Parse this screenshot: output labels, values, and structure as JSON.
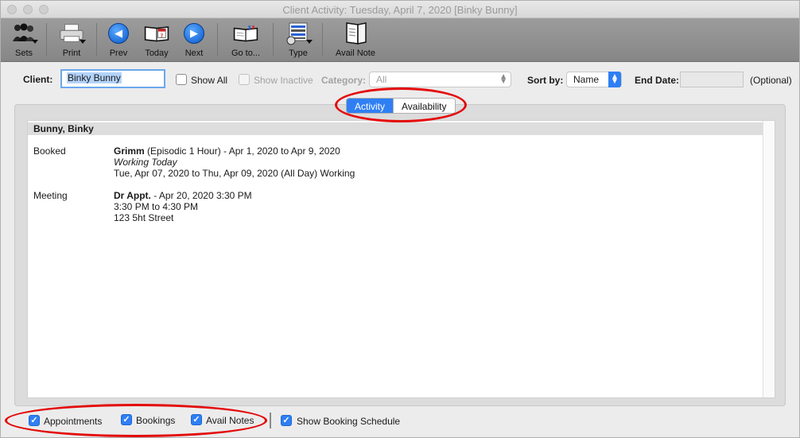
{
  "window": {
    "title": "Client Activity: Tuesday, April 7, 2020 [Binky Bunny]"
  },
  "toolbar": {
    "items": [
      {
        "label": "Sets",
        "icon": "people-icon"
      },
      {
        "label": "Print",
        "icon": "printer-icon"
      },
      {
        "label": "Prev",
        "icon": "arrow-left-icon"
      },
      {
        "label": "Today",
        "icon": "calendar-icon"
      },
      {
        "label": "Next",
        "icon": "arrow-right-icon"
      },
      {
        "label": "Go to...",
        "icon": "book-icon"
      },
      {
        "label": "Type",
        "icon": "list-type-icon"
      },
      {
        "label": "Avail Note",
        "icon": "notebook-icon"
      }
    ]
  },
  "filters": {
    "client_label": "Client:",
    "client_value": "Binky Bunny",
    "show_all": "Show All",
    "show_inactive": "Show Inactive",
    "category_label": "Category:",
    "category_value": "All",
    "sortby_label": "Sort by:",
    "sortby_value": "Name",
    "enddate_label": "End Date:",
    "optional": "(Optional)"
  },
  "tabs": {
    "activity": "Activity",
    "availability": "Availability"
  },
  "results": {
    "group": "Bunny, Binky",
    "booked": {
      "label": "Booked",
      "title": "Grimm",
      "title_rest": " (Episodic 1 Hour) - Apr 1, 2020 to Apr 9, 2020",
      "line2": "Working Today",
      "line3": "Tue, Apr 07, 2020 to Thu, Apr 09, 2020 (All Day) Working"
    },
    "meeting": {
      "label": "Meeting",
      "title": "Dr Appt.",
      "title_rest": " - Apr 20, 2020 3:30 PM",
      "line2": "3:30 PM to 4:30 PM",
      "line3": "123 5ht Street"
    }
  },
  "bottom": {
    "appointments": "Appointments",
    "bookings": "Bookings",
    "avail_notes": "Avail Notes",
    "show_booking_schedule": "Show Booking Schedule"
  },
  "colors": {
    "accent": "#2f7ff4",
    "highlight_oval": "#e40a0a"
  }
}
